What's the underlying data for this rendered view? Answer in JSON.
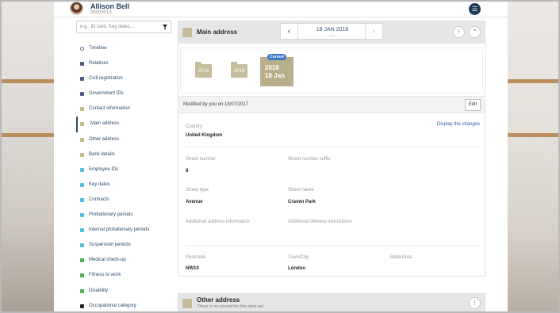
{
  "user": {
    "name": "Allison Bell",
    "id": "00000013"
  },
  "search": {
    "placeholder": "e.g.: ID card, Key dates,..."
  },
  "nav": [
    {
      "label": "Timeline",
      "color": "#ffffff"
    },
    {
      "label": "Relatives",
      "color": "#4b5e7d"
    },
    {
      "label": "Civil registration",
      "color": "#4b5e7d"
    },
    {
      "label": "Government IDs",
      "color": "#4b5e7d"
    },
    {
      "label": "Contact information",
      "color": "#c2b88f"
    },
    {
      "label": "Main address",
      "color": "#c2b88f"
    },
    {
      "label": "Other address",
      "color": "#c2b88f"
    },
    {
      "label": "Bank details",
      "color": "#c2b88f"
    },
    {
      "label": "Employee IDs",
      "color": "#4fbfd6"
    },
    {
      "label": "Key dates",
      "color": "#4fbfd6"
    },
    {
      "label": "Contracts",
      "color": "#4fbfd6"
    },
    {
      "label": "Probationary periods",
      "color": "#4fbfd6"
    },
    {
      "label": "Internal probationary periods",
      "color": "#4fbfd6"
    },
    {
      "label": "Suspension periods",
      "color": "#4fbfd6"
    },
    {
      "label": "Medical check-up",
      "color": "#4caf50"
    },
    {
      "label": "Fitness to work",
      "color": "#4caf50"
    },
    {
      "label": "Disability",
      "color": "#4caf50"
    },
    {
      "label": "Occupational category",
      "color": "#222222"
    }
  ],
  "main_address": {
    "title": "Main address",
    "date_label": "18 JAN 2018",
    "date_dots": "•••",
    "history": {
      "folder1": "2016",
      "folder2": "2018",
      "current_year": "2018",
      "current_date": "18 Jan",
      "badge": "Current"
    },
    "modified_text": "Modified by you on 19/07/2017",
    "edit_label": "Edit",
    "changes_link": "Display the changes",
    "country": {
      "label": "Country",
      "value": "United Kingdom"
    },
    "street_number": {
      "label": "Street number",
      "value": "8"
    },
    "street_number_suffix": {
      "label": "Street number suffix",
      "value": ""
    },
    "street_type": {
      "label": "Street type",
      "value": "Avenue"
    },
    "street_name": {
      "label": "Street name",
      "value": "Craven Park"
    },
    "additional_info": {
      "label": "Additional address information",
      "value": ""
    },
    "delivery_instructions": {
      "label": "Additional delivery instructions",
      "value": ""
    },
    "postcode": {
      "label": "Postcode",
      "value": "NW10"
    },
    "town": {
      "label": "Town/City",
      "value": "London"
    },
    "state": {
      "label": "State/Area",
      "value": ""
    }
  },
  "other_address": {
    "title": "Other address",
    "subtitle": "There is no record for this data set."
  },
  "colors": {
    "accent": "#c6bd9b",
    "navy": "#223a5a",
    "link": "#2b5aa5",
    "badge": "#3a76c5"
  },
  "icons": {
    "menu": "hamburger-icon",
    "filter": "filter-icon",
    "more": "more-vertical-icon",
    "collapse": "chevron-up-icon"
  }
}
